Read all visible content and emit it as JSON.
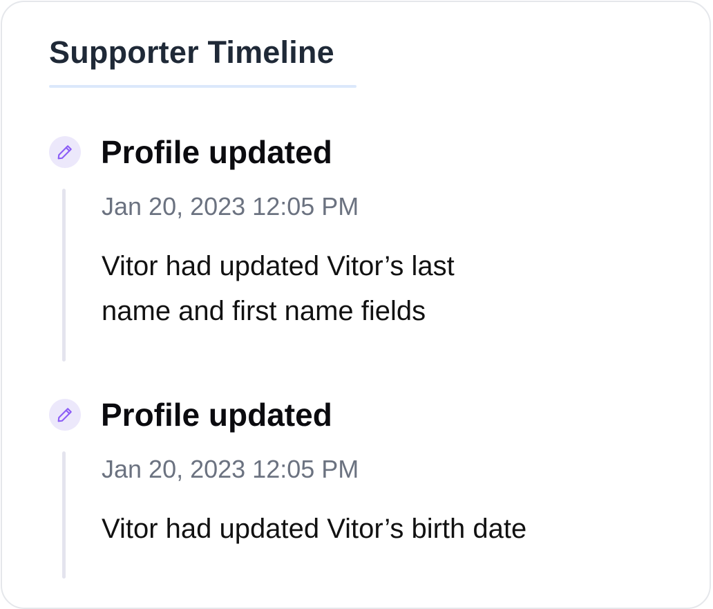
{
  "card": {
    "title": "Supporter Timeline"
  },
  "events": [
    {
      "icon": "pencil-icon",
      "title": "Profile updated",
      "timestamp": "Jan 20, 2023 12:05 PM",
      "description": "Vitor had updated Vitor’s last name and first name fields"
    },
    {
      "icon": "pencil-icon",
      "title": "Profile updated",
      "timestamp": "Jan 20, 2023 12:05 PM",
      "description": "Vitor had updated Vitor’s birth date"
    }
  ],
  "colors": {
    "icon_accent": "#8b5cf6",
    "icon_background": "#ece8fb",
    "title_underline": "#dbe8fb",
    "timestamp_text": "#6b7280",
    "rail": "#e4e4ee"
  }
}
